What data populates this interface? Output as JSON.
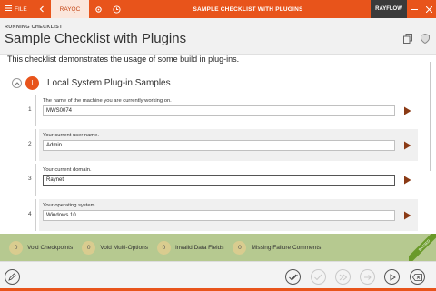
{
  "topbar": {
    "file_label": "FILE",
    "rayqc_tab": "RAYQC",
    "title": "SAMPLE CHECKLIST WITH PLUGINS",
    "rayflow_tab": "RAYFLOW",
    "icons": [
      "menu-icon",
      "back-arrow-icon",
      "gear-icon",
      "clock-icon"
    ]
  },
  "header": {
    "caption": "RUNNING CHECKLIST",
    "heading": "Sample Checklist with Plugins"
  },
  "description": "This checklist demonstrates the usage of some build in plug-ins.",
  "section": {
    "badge": "I",
    "title": "Local System Plug-in Samples"
  },
  "rows": [
    {
      "num": "1",
      "label": "The name of the machine you are currently working on.",
      "value": "MWS0074"
    },
    {
      "num": "2",
      "label": "Your current user name.",
      "value": "Admin"
    },
    {
      "num": "3",
      "label": "Your current domain.",
      "value": "Raynet"
    },
    {
      "num": "4",
      "label": "Your operating system.",
      "value": "Windows 10"
    }
  ],
  "status": {
    "items": [
      {
        "count": "0",
        "label": "Void Checkpoints"
      },
      {
        "count": "0",
        "label": "Void Multi-Options"
      },
      {
        "count": "0",
        "label": "Invalid Data Fields"
      },
      {
        "count": "0",
        "label": "Missing Failure Comments"
      }
    ],
    "ribbon": "PASSED"
  },
  "colors": {
    "accent": "#e8541b",
    "status_bar": "#b6c990",
    "count_badge": "#d9cc8f"
  }
}
